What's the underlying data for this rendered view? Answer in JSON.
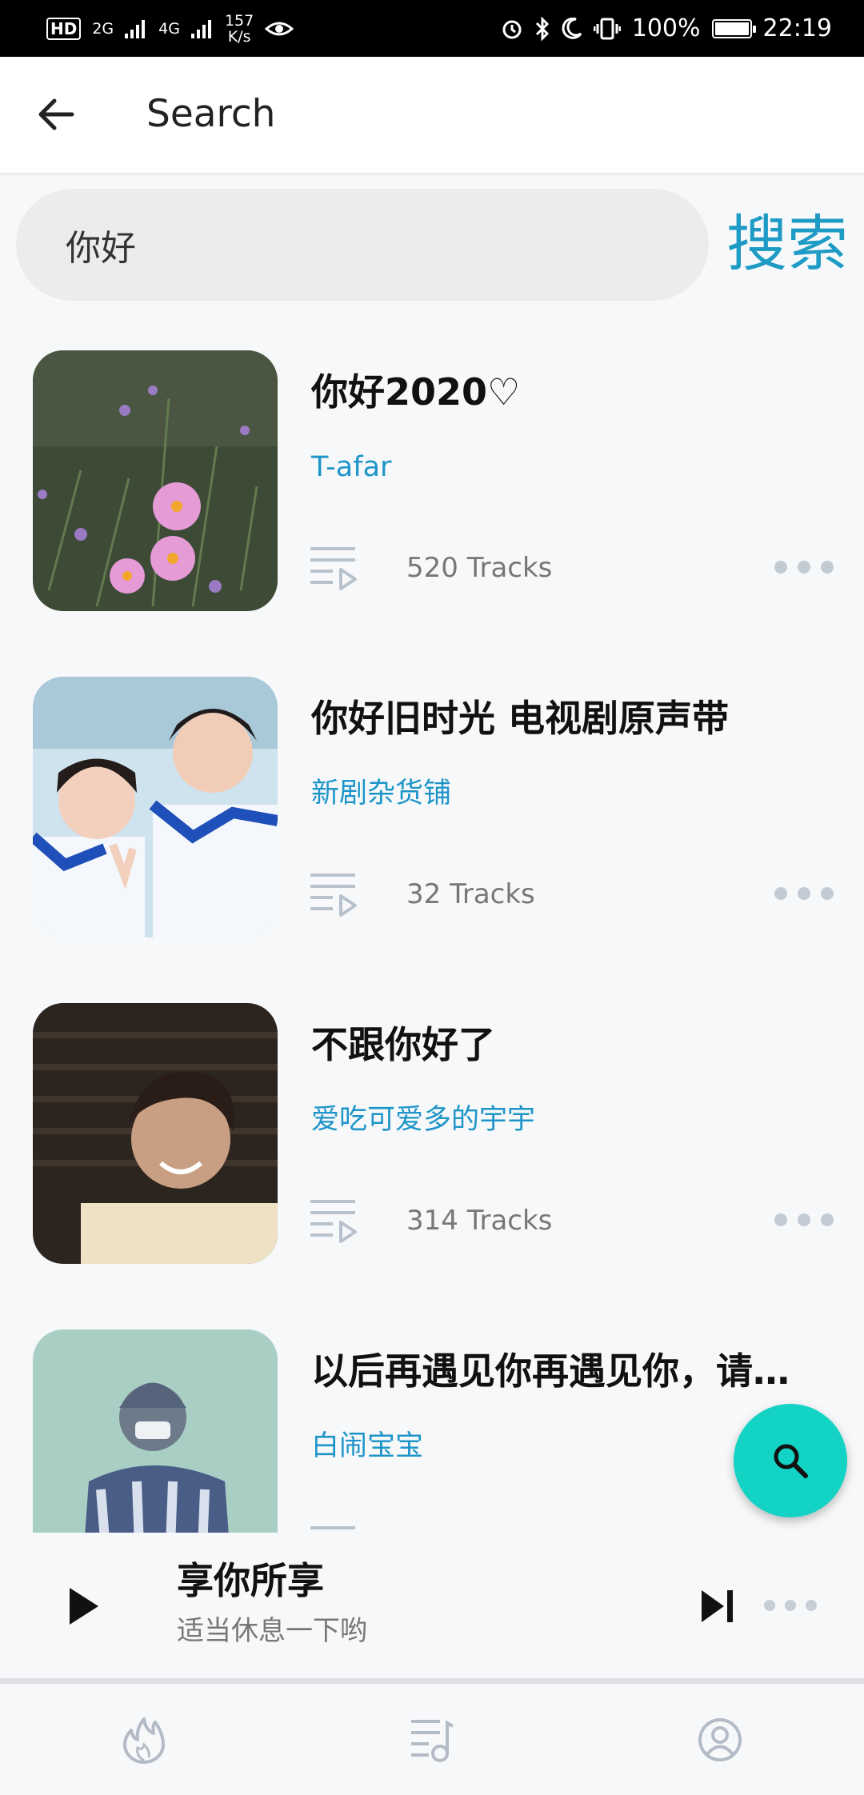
{
  "status_bar": {
    "hd_badge": "HD",
    "net_speed_value": "157",
    "net_speed_unit": "K/s",
    "signal_1": "2G",
    "signal_2": "4G",
    "battery_percent": "100%",
    "battery_level": 1.0,
    "time": "22:19"
  },
  "app_bar": {
    "title": "Search",
    "back_icon": "arrow-left-icon"
  },
  "search": {
    "query": "你好",
    "button_label": "搜索"
  },
  "results": [
    {
      "title": "你好2020♡",
      "author": "T-afar",
      "tracks": "520 Tracks",
      "cover": "pink-cosmos-flowers"
    },
    {
      "title": "你好旧时光 电视剧原声带",
      "author": "新剧杂货铺",
      "tracks": "32 Tracks",
      "cover": "two-students-photo"
    },
    {
      "title": "不跟你好了",
      "author": "爱吃可爱多的宇宇",
      "tracks": "314 Tracks",
      "cover": "smiling-man-photo"
    },
    {
      "title": "以后再遇见你再遇见你，请你...",
      "author": "白闹宝宝",
      "tracks": "",
      "cover": "masked-person-illustration"
    }
  ],
  "player": {
    "title": "享你所享",
    "subtitle": "适当休息一下哟"
  },
  "colors": {
    "accent": "#1e9bc4",
    "fab": "#13d3c5",
    "background": "#f7f8fa"
  },
  "bottom_nav": [
    "flame-icon",
    "playlist-icon",
    "profile-icon"
  ]
}
